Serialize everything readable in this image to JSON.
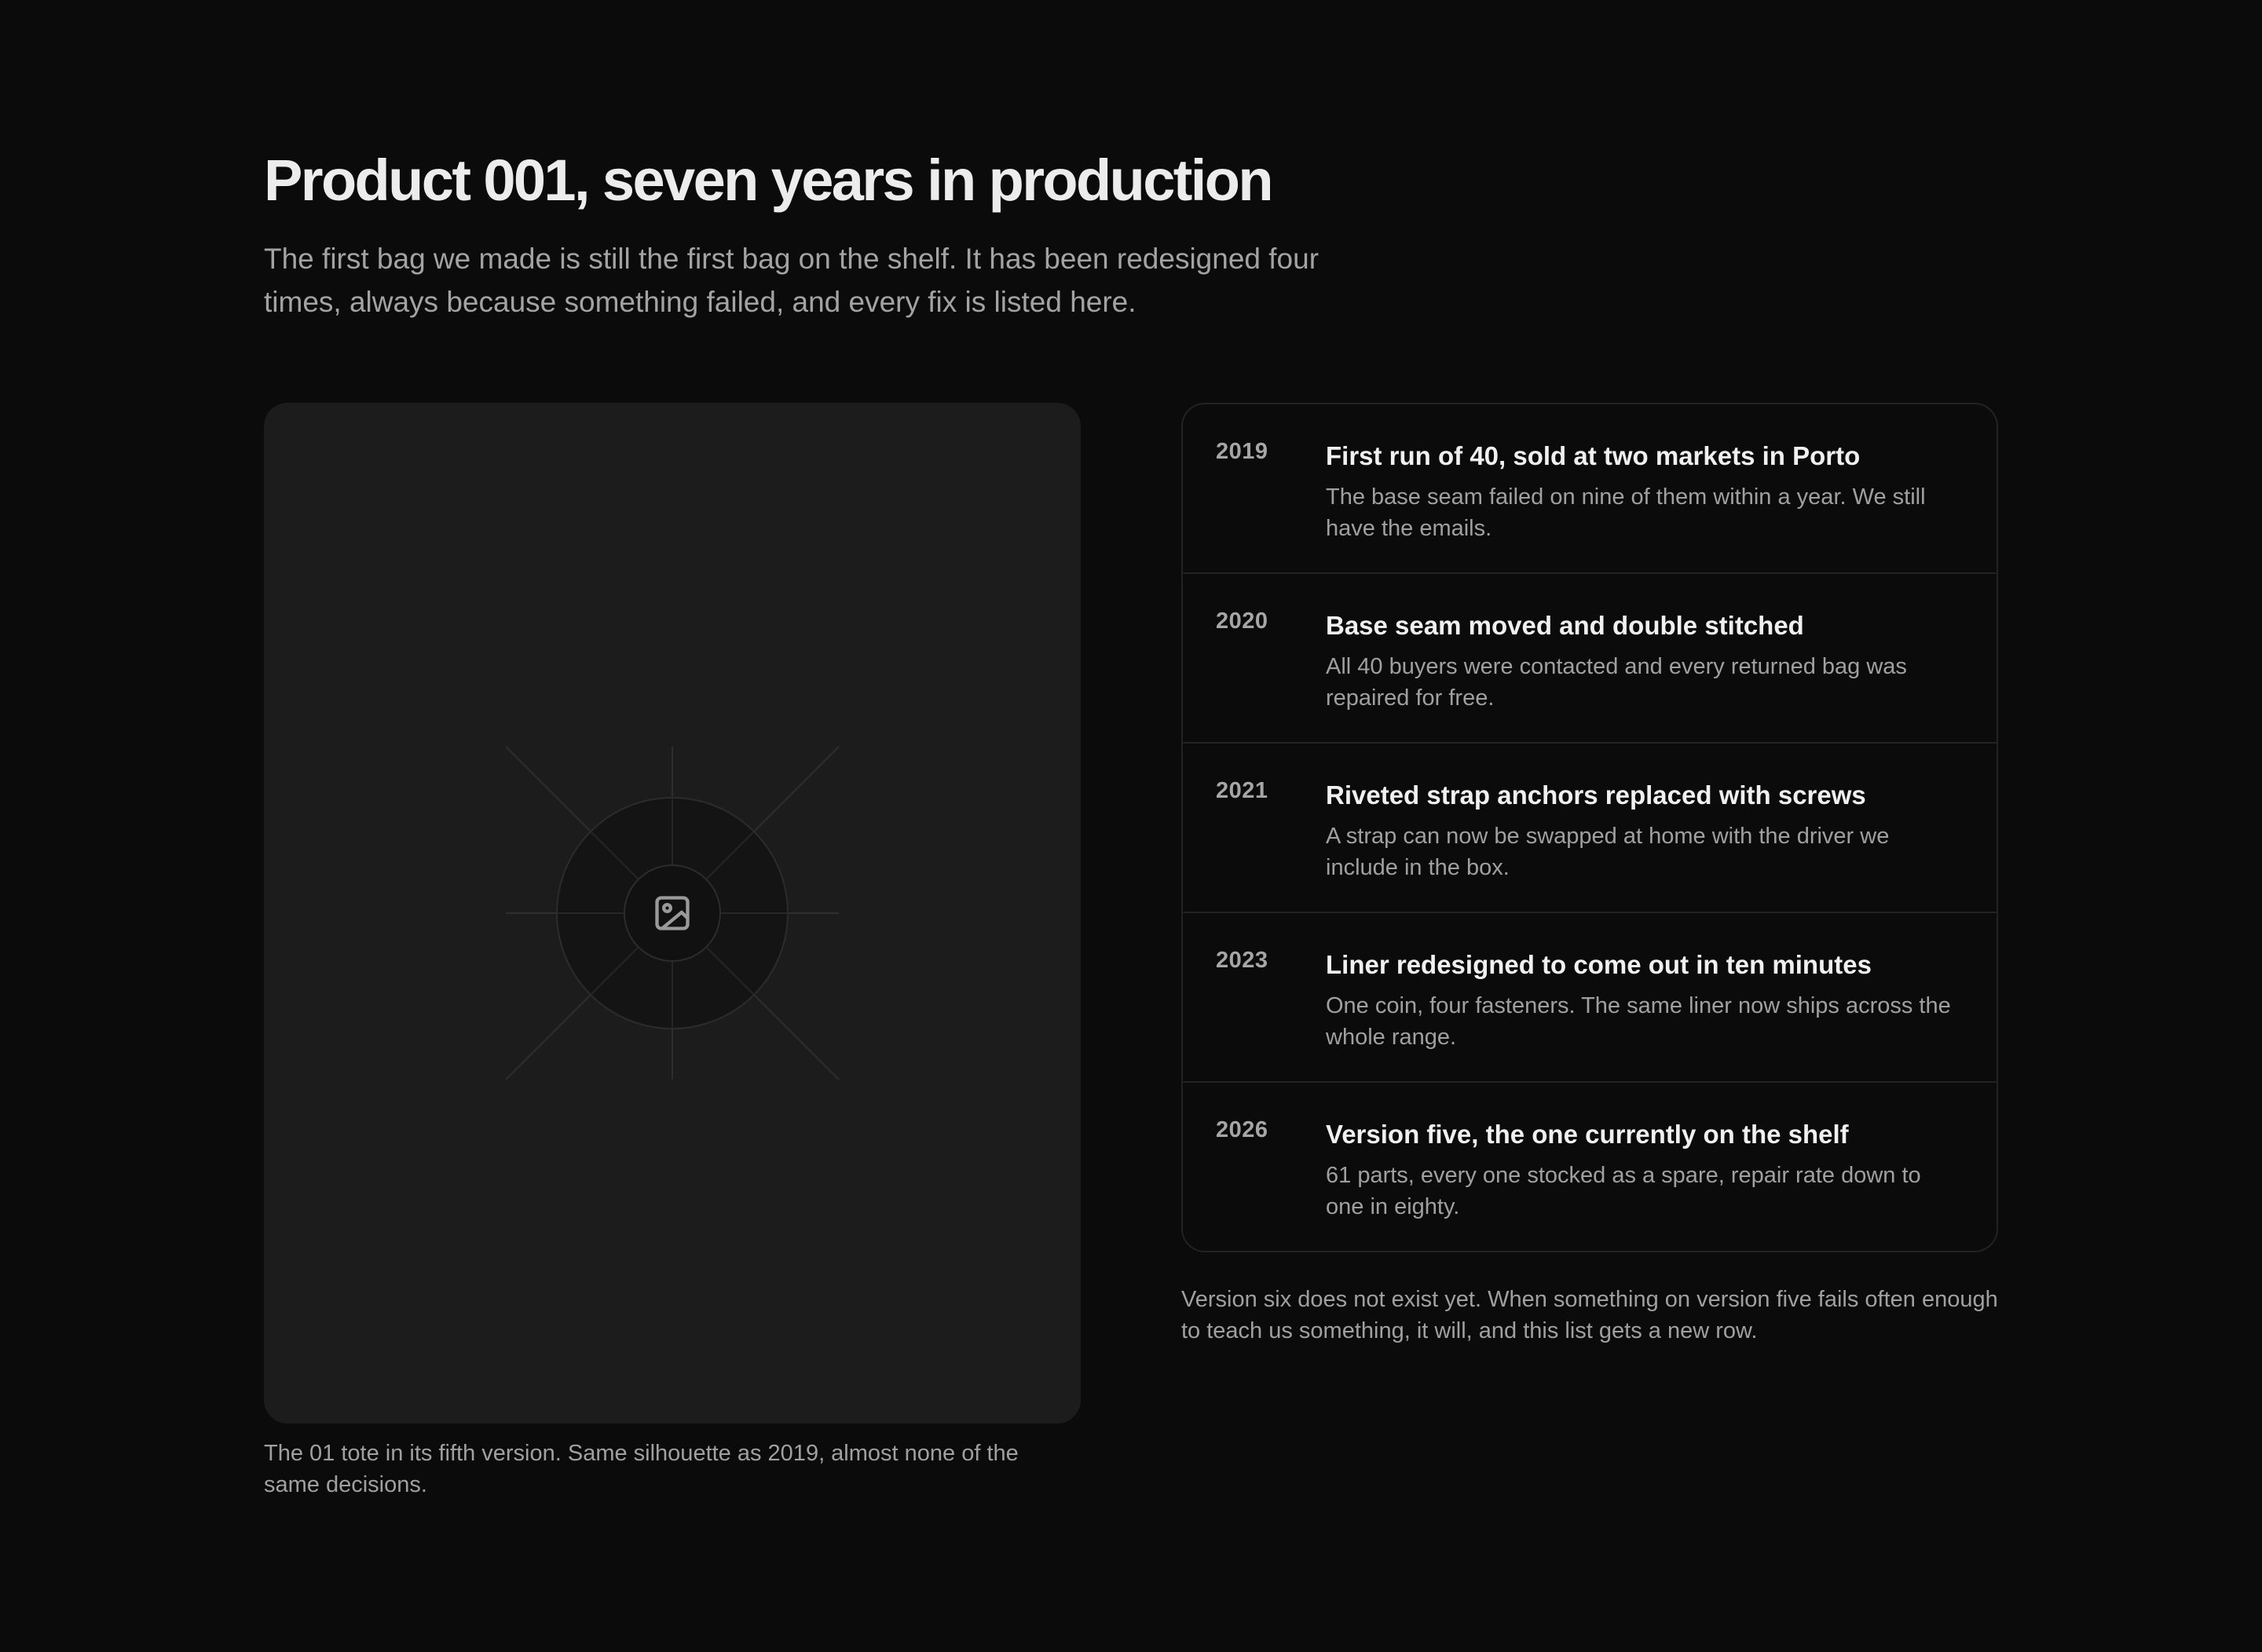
{
  "header": {
    "title": "Product 001, seven years in production",
    "subtitle": "The first bag we made is still the first bag on the shelf. It has been redesigned four times, always because something failed, and every fix is listed here."
  },
  "media": {
    "icon": "image-placeholder-icon",
    "caption": "The 01 tote in its fifth version. Same silhouette as 2019, almost none of the same decisions."
  },
  "timeline": {
    "entries": [
      {
        "year": "2019",
        "title": "First run of 40, sold at two markets in Porto",
        "detail": "The base seam failed on nine of them within a year. We still have the emails."
      },
      {
        "year": "2020",
        "title": "Base seam moved and double stitched",
        "detail": "All 40 buyers were contacted and every returned bag was repaired for free."
      },
      {
        "year": "2021",
        "title": "Riveted strap anchors replaced with screws",
        "detail": "A strap can now be swapped at home with the driver we include in the box."
      },
      {
        "year": "2023",
        "title": "Liner redesigned to come out in ten minutes",
        "detail": "One coin, four fasteners. The same liner now ships across the whole range."
      },
      {
        "year": "2026",
        "title": "Version five, the one currently on the shelf",
        "detail": "61 parts, every one stocked as a spare, repair rate down to one in eighty."
      }
    ],
    "footnote": "Version six does not exist yet. When something on version five fails often enough to teach us something, it will, and this list gets a new row."
  },
  "colors": {
    "background": "#0b0b0b",
    "panel": "#1c1c1c",
    "border": "#222222",
    "text_primary": "#f0f0f0",
    "text_secondary": "#a0a0a0"
  }
}
